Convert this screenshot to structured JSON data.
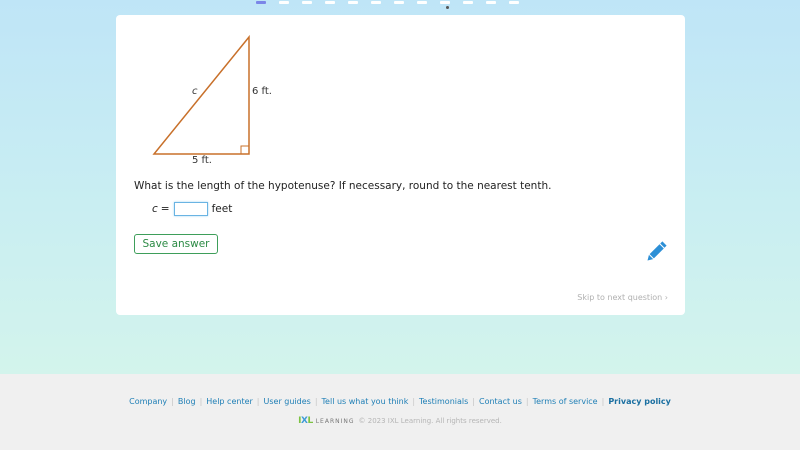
{
  "progress": {
    "dash_count": 13,
    "active_index": 0
  },
  "triangle": {
    "hypotenuse_label": "c",
    "vertical_label": "6 ft.",
    "base_label": "5 ft.",
    "stroke_color": "#c8702a"
  },
  "question": {
    "text": "What is the length of the hypotenuse? If necessary, round to the nearest tenth.",
    "variable": "c",
    "equals": "=",
    "input_value": "",
    "unit": "feet"
  },
  "actions": {
    "save_label": "Save answer",
    "skip_label": "Skip to next question ›"
  },
  "colors": {
    "accent_green": "#3e9e5a",
    "pencil_blue": "#2c8fd6",
    "link_blue": "#1f7fb6"
  },
  "footer": {
    "links": [
      {
        "label": "Company"
      },
      {
        "label": "Blog"
      },
      {
        "label": "Help center"
      },
      {
        "label": "User guides"
      },
      {
        "label": "Tell us what you think"
      },
      {
        "label": "Testimonials"
      },
      {
        "label": "Contact us"
      },
      {
        "label": "Terms of service"
      },
      {
        "label": "Privacy policy"
      }
    ],
    "logo_mark_i": "I",
    "logo_mark_x": "X",
    "logo_mark_l": "L",
    "logo_word": "LEARNING",
    "copyright": "© 2023 IXL Learning. All rights reserved."
  }
}
